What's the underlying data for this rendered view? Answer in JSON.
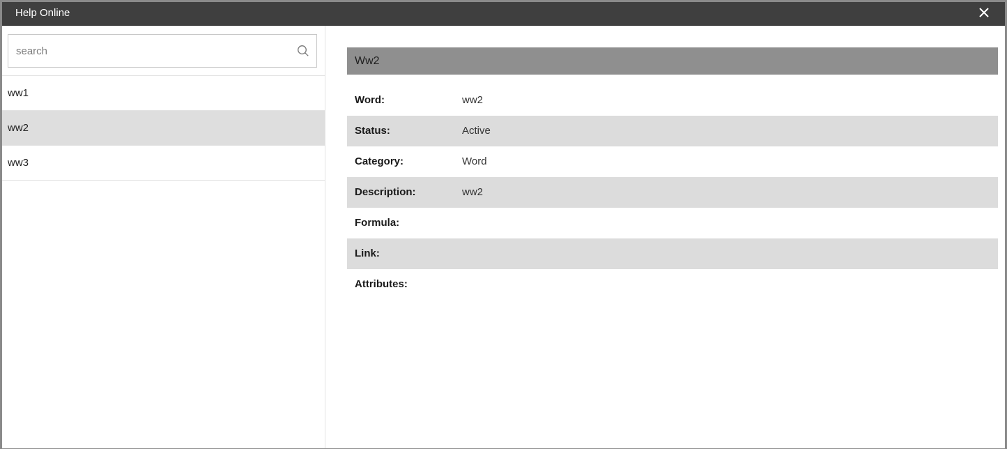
{
  "window": {
    "title": "Help Online"
  },
  "search": {
    "placeholder": "search",
    "value": ""
  },
  "words": [
    {
      "label": "ww1",
      "selected": false
    },
    {
      "label": "ww2",
      "selected": true
    },
    {
      "label": "ww3",
      "selected": false
    }
  ],
  "detail": {
    "title": "Ww2",
    "rows": [
      {
        "label": "Word:",
        "value": "ww2"
      },
      {
        "label": "Status:",
        "value": "Active"
      },
      {
        "label": "Category:",
        "value": "Word"
      },
      {
        "label": "Description:",
        "value": "ww2"
      },
      {
        "label": "Formula:",
        "value": ""
      },
      {
        "label": "Link:",
        "value": ""
      },
      {
        "label": "Attributes:",
        "value": ""
      }
    ]
  },
  "colors": {
    "titlebar": "#3f3f3f",
    "header": "#8f8f8f",
    "row_alt": "#dcdcdc",
    "selected": "#dedede"
  },
  "icons": {
    "close": "close-icon",
    "search": "search-icon"
  }
}
